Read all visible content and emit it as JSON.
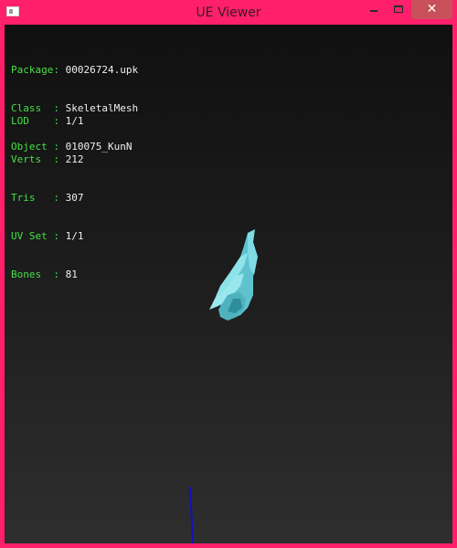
{
  "window": {
    "title": "UE Viewer",
    "controls": {
      "minimize_icon": "minimize-icon",
      "maximize_icon": "maximize-icon",
      "close_glyph": "✕"
    }
  },
  "info": {
    "header": [
      {
        "label": "Package",
        "sep": ": ",
        "value": "00026724.upk"
      },
      {
        "label": "Class  ",
        "sep": ": ",
        "value": "SkeletalMesh"
      },
      {
        "label": "Object ",
        "sep": ": ",
        "value": "010075_KunN"
      }
    ],
    "stats": [
      {
        "label": "LOD    ",
        "sep": ": ",
        "value": "1/1"
      },
      {
        "label": "Verts  ",
        "sep": ": ",
        "value": "212"
      },
      {
        "label": "Tris   ",
        "sep": ": ",
        "value": "307"
      },
      {
        "label": "UV Set ",
        "sep": ": ",
        "value": "1/1"
      },
      {
        "label": "Bones  ",
        "sep": ": ",
        "value": "81"
      }
    ]
  },
  "colors": {
    "window_frame": "#ff1f6b",
    "label": "#46e046",
    "value": "#f0f0f0",
    "mesh": "#6fd0da",
    "axis": "#1010c8"
  }
}
